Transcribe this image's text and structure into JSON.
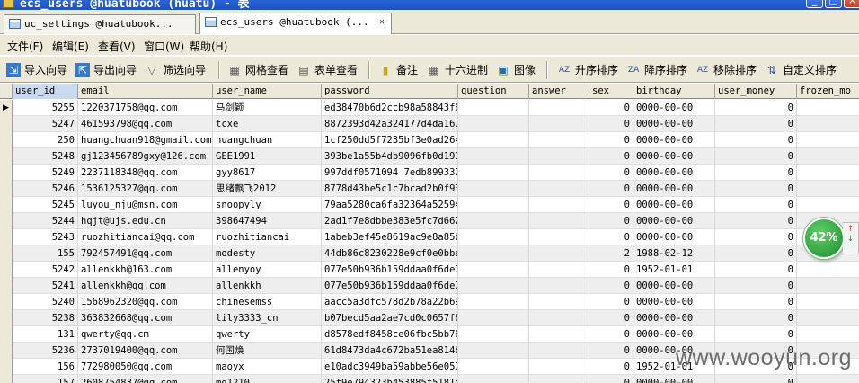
{
  "window": {
    "title": "ecs_users @huatubook (huatu) - 表",
    "minimize": "_",
    "maximize": "□",
    "close": "×"
  },
  "tabs": [
    {
      "label": "uc_settings @huatubook..."
    },
    {
      "label": "ecs_users @huatubook (..."
    }
  ],
  "menu": [
    "文件(F)",
    "编辑(E)",
    "查看(V)",
    "窗口(W)",
    "帮助(H)"
  ],
  "toolbar": {
    "import": "导入向导",
    "export": "导出向导",
    "filter": "筛选向导",
    "grid_view": "网格查看",
    "form_view": "表单查看",
    "memo": "备注",
    "hex": "十六进制",
    "image": "图像",
    "sort_asc": "升序排序",
    "sort_desc": "降序排序",
    "remove_sort": "移除排序",
    "custom_sort": "自定义排序"
  },
  "columns": [
    "user_id",
    "email",
    "user_name",
    "password",
    "question",
    "answer",
    "sex",
    "birthday",
    "user_money",
    "frozen_mo"
  ],
  "rows": [
    [
      "5255",
      "1220371758@qq.com",
      "马剑颖",
      "ed38470b6d2ccb98a58843f61",
      "",
      "",
      "0",
      "0000-00-00",
      "0",
      ""
    ],
    [
      "5247",
      "461593798@qq.com",
      "tcxe",
      "8872393d42a324177d4da1679",
      "",
      "",
      "0",
      "0000-00-00",
      "0",
      ""
    ],
    [
      "250",
      "huangchuan918@gmail.com",
      "huangchuan",
      "1cf250dd5f7235bf3e0ad2648",
      "",
      "",
      "0",
      "0000-00-00",
      "0",
      ""
    ],
    [
      "5248",
      "gj123456789gxy@126.com",
      "GEE1991",
      "393be1a55b4db9096fb0d1914",
      "",
      "",
      "0",
      "0000-00-00",
      "0",
      ""
    ],
    [
      "5249",
      "2237118348@qq.com",
      "gyy8617",
      "997ddf0571094 7edb8993321",
      "",
      "",
      "0",
      "0000-00-00",
      "0",
      ""
    ],
    [
      "5246",
      "1536125327@qq.com",
      "思绪飘飞2012",
      "8778d43be5c1c7bcad2b0f931",
      "",
      "",
      "0",
      "0000-00-00",
      "0",
      ""
    ],
    [
      "5245",
      "luyou_nju@msn.com",
      "snoopyly",
      "79aa5280ca6fa32364a52594",
      "",
      "",
      "0",
      "0000-00-00",
      "0",
      ""
    ],
    [
      "5244",
      "hqjt@ujs.edu.cn",
      "398647494",
      "2ad1f7e8dbbe383e5fc7d6624",
      "",
      "",
      "0",
      "0000-00-00",
      "0",
      ""
    ],
    [
      "5243",
      "ruozhitiancai@qq.com",
      "ruozhitiancai",
      "1abeb3ef45e8619ac9e8a85b3",
      "",
      "",
      "0",
      "0000-00-00",
      "0",
      ""
    ],
    [
      "155",
      "792457491@qq.com",
      "modesty",
      "44db86c8230228e9cf0e0bbe",
      "",
      "",
      "2",
      "1988-02-12",
      "0",
      ""
    ],
    [
      "5242",
      "allenkkh@163.com",
      "allenyoy",
      "077e50b936b159ddaa0f6de7",
      "",
      "",
      "0",
      "1952-01-01",
      "0",
      ""
    ],
    [
      "5241",
      "allenkkh@qq.com",
      "allenkkh",
      "077e50b936b159ddaa0f6de7",
      "",
      "",
      "0",
      "0000-00-00",
      "0",
      ""
    ],
    [
      "5240",
      "1568962320@qq.com",
      "chinesemss",
      "aacc5a3dfc578d2b78a22b694",
      "",
      "",
      "0",
      "0000-00-00",
      "0",
      ""
    ],
    [
      "5238",
      "363832668@qq.com",
      "lily3333_cn",
      "b07becd5aa2ae7cd0c0657f69",
      "",
      "",
      "0",
      "0000-00-00",
      "0",
      ""
    ],
    [
      "131",
      "qwerty@qq.cm",
      "qwerty",
      "d8578edf8458ce06fbc5bb76",
      "",
      "",
      "0",
      "0000-00-00",
      "0",
      ""
    ],
    [
      "5236",
      "2737019400@qq.com",
      "何国焕",
      "61d8473da4c672ba51ea814b",
      "",
      "",
      "0",
      "0000-00-00",
      "0",
      ""
    ],
    [
      "156",
      "772980050@qq.com",
      "maoyx",
      "e10adc3949ba59abbe56e057",
      "",
      "",
      "0",
      "1952-01-01",
      "0",
      ""
    ],
    [
      "157",
      "2608754837@qq.com",
      "mg1210",
      "25f9e794323b453885f5181f",
      "",
      "",
      "0",
      "0000-00-00",
      "0",
      ""
    ]
  ],
  "badge": {
    "percent": "42%",
    "up": "↑",
    "down": "↓"
  },
  "watermark": "www.wooyun.org"
}
